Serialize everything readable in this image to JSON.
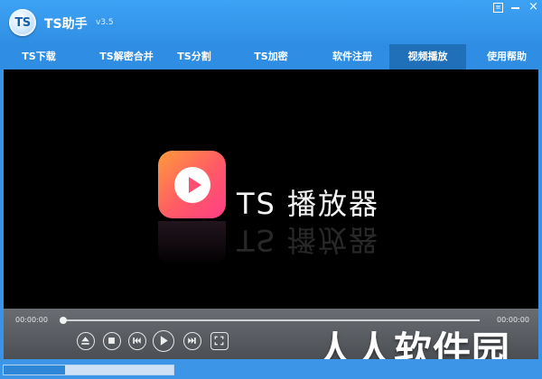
{
  "window": {
    "logo_text": "TS",
    "title": "TS助手",
    "version": "v3.5"
  },
  "nav": {
    "tabs": [
      {
        "label": "TS下载",
        "active": false
      },
      {
        "label": "TS解密合并",
        "active": false
      },
      {
        "label": "TS分割",
        "active": false
      },
      {
        "label": "TS加密",
        "active": false
      },
      {
        "label": "软件注册",
        "active": false
      },
      {
        "label": "视频播放",
        "active": true
      },
      {
        "label": "使用帮助",
        "active": false
      }
    ]
  },
  "player": {
    "name": "TS 播放器",
    "current_time": "00:00:00",
    "total_time": "00:00:00",
    "progress": 0
  },
  "watermark": "人人软件园",
  "status": {
    "progress_fraction": 0.36
  },
  "colors": {
    "titlebar": "#3da3f5",
    "active_tab": "#1f6fb9",
    "logo_gradient_start": "#ff9a3b",
    "logo_gradient_end": "#ff3e86"
  }
}
